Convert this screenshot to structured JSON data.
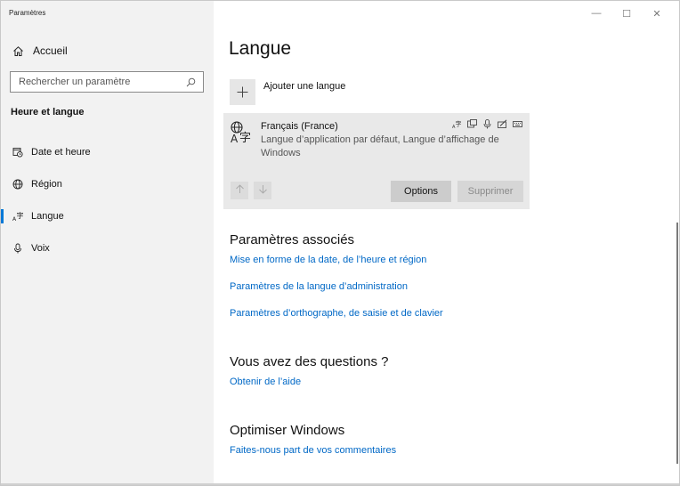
{
  "window": {
    "title": "Paramètres",
    "controls": {
      "minimize_glyph": "—",
      "maximize_glyph": "☐",
      "close_glyph": "✕"
    }
  },
  "sidebar": {
    "home_label": "Accueil",
    "search_placeholder": "Rechercher un paramètre",
    "section_title": "Heure et langue",
    "items": [
      {
        "label": "Date et heure",
        "icon": "calendar-clock-icon"
      },
      {
        "label": "Région",
        "icon": "globe-icon"
      },
      {
        "label": "Langue",
        "icon": "language-icon",
        "active": true
      },
      {
        "label": "Voix",
        "icon": "microphone-icon"
      }
    ]
  },
  "main": {
    "title": "Langue",
    "add_language_label": "Ajouter une langue",
    "language_card": {
      "name": "Français (France)",
      "description": "Langue d’application par défaut, Langue d’affichage de Windows",
      "feature_icons": [
        "display-language-icon",
        "text-to-speech-icon",
        "speech-icon",
        "handwriting-icon",
        "keyboard-icon"
      ],
      "options_label": "Options",
      "remove_label": "Supprimer"
    },
    "related": {
      "heading": "Paramètres associés",
      "links": [
        "Mise en forme de la date, de l’heure et région",
        "Paramètres de la langue d’administration",
        "Paramètres d’orthographe, de saisie et de clavier"
      ]
    },
    "questions": {
      "heading": "Vous avez des questions ?",
      "link": "Obtenir de l’aide"
    },
    "improve": {
      "heading": "Optimiser Windows",
      "link": "Faites-nous part de vos commentaires"
    }
  },
  "colors": {
    "accent": "#0078d7",
    "link": "#0068c6",
    "sidebar_bg": "#f2f2f2",
    "card_bg": "#e9e9e9"
  }
}
